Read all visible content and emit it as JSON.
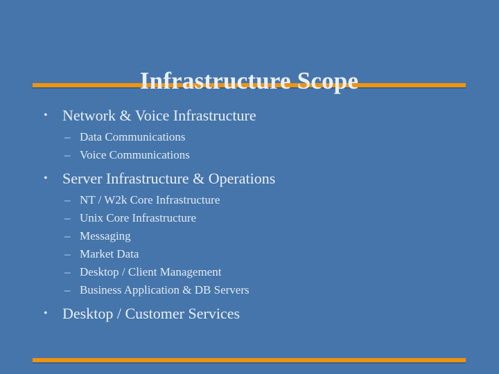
{
  "slide": {
    "title": "Infrastructure Scope",
    "background_color": "#4575AA",
    "text_color": "#E9EFF7",
    "rule_color": "#EE9411",
    "bullet_marker_level1": "•",
    "bullet_marker_level2": "–",
    "content": [
      {
        "level": 1,
        "text": "Network & Voice Infrastructure"
      },
      {
        "level": 2,
        "text": "Data Communications"
      },
      {
        "level": 2,
        "text": "Voice Communications"
      },
      {
        "level": 1,
        "text": "Server Infrastructure & Operations"
      },
      {
        "level": 2,
        "text": "NT / W2k Core Infrastructure"
      },
      {
        "level": 2,
        "text": "Unix Core Infrastructure"
      },
      {
        "level": 2,
        "text": "Messaging"
      },
      {
        "level": 2,
        "text": "Market Data"
      },
      {
        "level": 2,
        "text": "Desktop / Client Management"
      },
      {
        "level": 2,
        "text": "Business Application & DB Servers"
      },
      {
        "level": 1,
        "text": "Desktop / Customer Services"
      }
    ]
  }
}
